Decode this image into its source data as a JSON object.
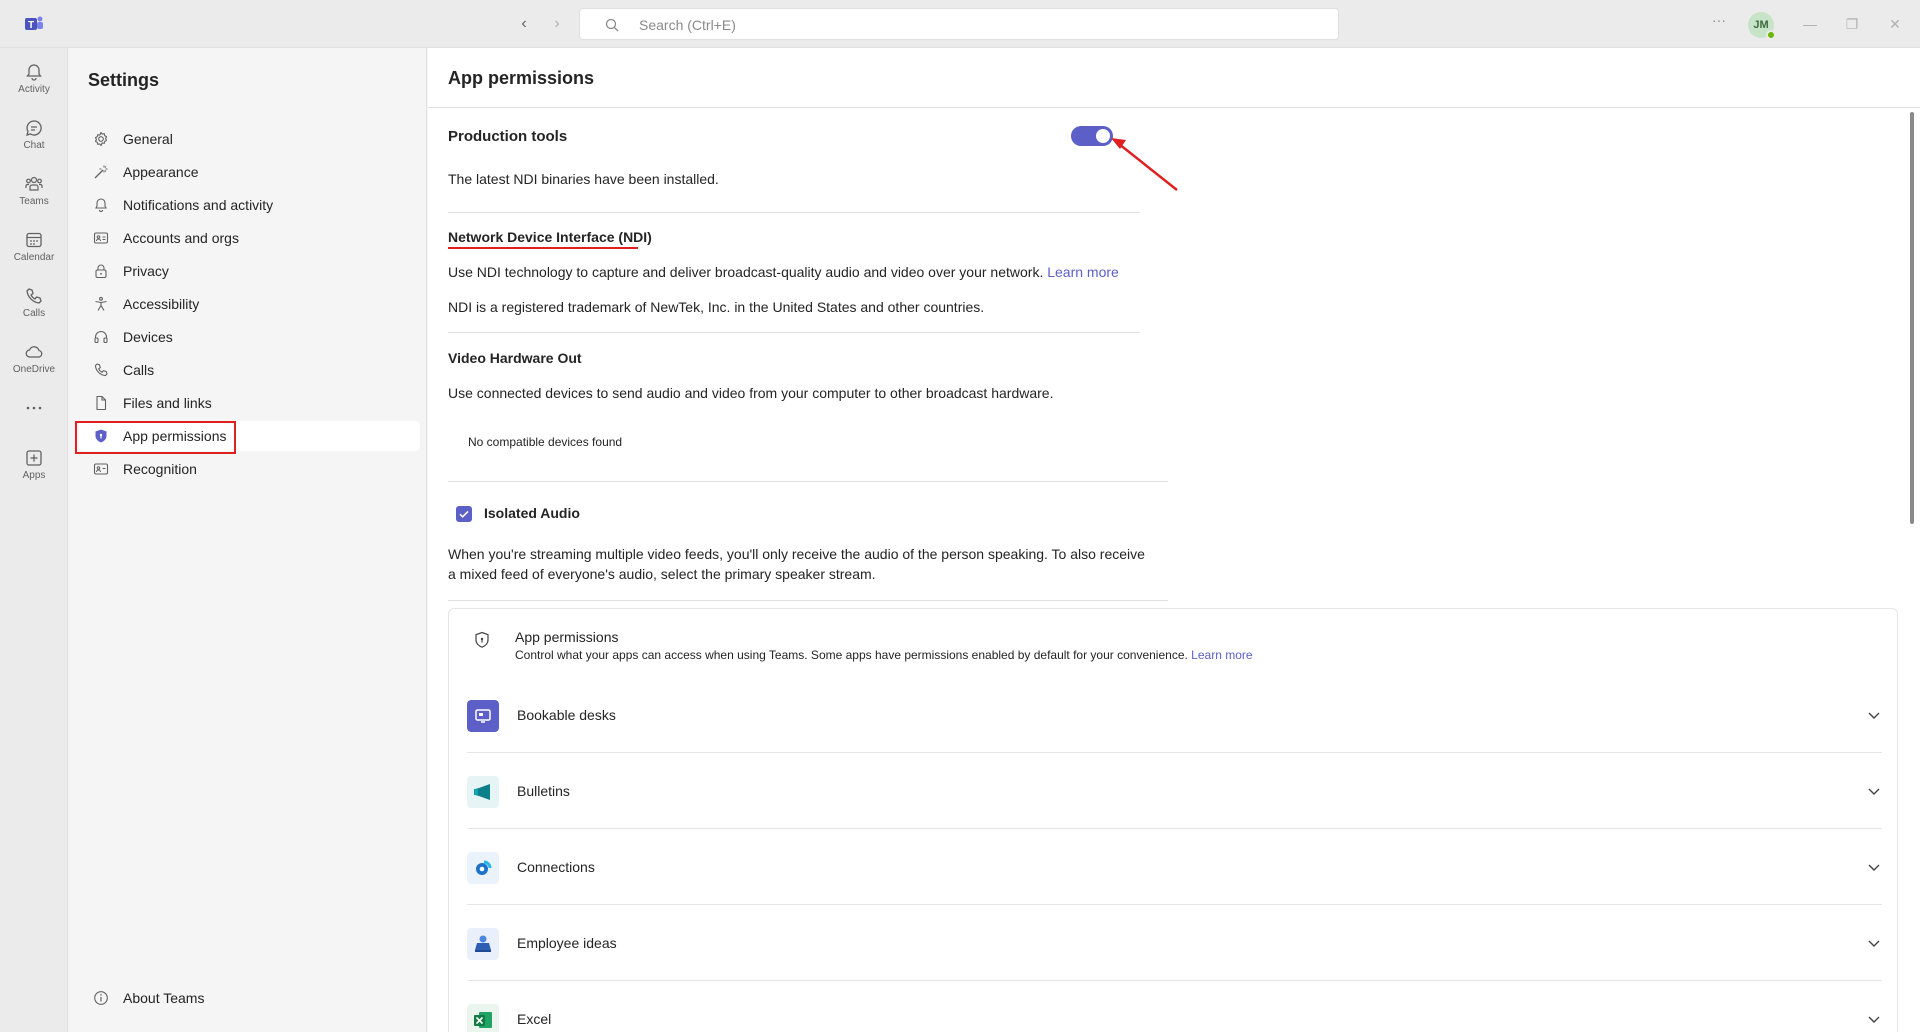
{
  "titlebar": {
    "search_placeholder": "Search (Ctrl+E)",
    "more_label": "···",
    "avatar_initials": "JM"
  },
  "rail": {
    "items": [
      {
        "label": "Activity",
        "icon": "bell-icon"
      },
      {
        "label": "Chat",
        "icon": "chat-icon"
      },
      {
        "label": "Teams",
        "icon": "teams-icon"
      },
      {
        "label": "Calendar",
        "icon": "calendar-icon"
      },
      {
        "label": "Calls",
        "icon": "phone-icon"
      },
      {
        "label": "OneDrive",
        "icon": "cloud-icon"
      },
      {
        "label": "",
        "icon": "more-icon"
      },
      {
        "label": "Apps",
        "icon": "add-apps-icon"
      }
    ]
  },
  "settings": {
    "title": "Settings",
    "items": [
      {
        "label": "General",
        "icon": "gear-icon"
      },
      {
        "label": "Appearance",
        "icon": "wand-icon"
      },
      {
        "label": "Notifications and activity",
        "icon": "bell-icon"
      },
      {
        "label": "Accounts and orgs",
        "icon": "id-card-icon"
      },
      {
        "label": "Privacy",
        "icon": "lock-icon"
      },
      {
        "label": "Accessibility",
        "icon": "accessibility-icon"
      },
      {
        "label": "Devices",
        "icon": "headset-icon"
      },
      {
        "label": "Calls",
        "icon": "phone-icon"
      },
      {
        "label": "Files and links",
        "icon": "document-icon"
      },
      {
        "label": "App permissions",
        "icon": "shield-icon"
      },
      {
        "label": "Recognition",
        "icon": "recognition-icon"
      }
    ],
    "about": "About Teams",
    "active_item": "App permissions"
  },
  "main": {
    "title": "App permissions",
    "production_tools": {
      "heading": "Production tools",
      "toggle_on": true,
      "status": "The latest NDI binaries have been installed."
    },
    "ndi": {
      "heading": "Network Device Interface (NDI)",
      "desc": "Use NDI technology to capture and deliver broadcast-quality audio and video over your network.",
      "learn_more": "Learn more",
      "trademark": "NDI is a registered trademark of NewTek, Inc. in the United States and other countries."
    },
    "video_out": {
      "heading": "Video Hardware Out",
      "desc": "Use connected devices to send audio and video from your computer to other broadcast hardware.",
      "no_devices": "No compatible devices found"
    },
    "isolated_audio": {
      "label": "Isolated Audio",
      "checked": true,
      "desc_line1": "When you're streaming multiple video feeds, you'll only receive the audio of the person speaking. To also receive",
      "desc_line2": "a mixed feed of everyone's audio, select the primary speaker stream."
    },
    "app_permissions": {
      "title": "App permissions",
      "desc": "Control what your apps can access when using Teams. Some apps have permissions enabled by default for your convenience.",
      "learn_more": "Learn more",
      "apps": [
        {
          "name": "Bookable desks",
          "color": "#5b5fc7"
        },
        {
          "name": "Bulletins",
          "color": "#0b7f8a"
        },
        {
          "name": "Connections",
          "color": "#1a73c8"
        },
        {
          "name": "Employee ideas",
          "color": "#2f5fb3"
        },
        {
          "name": "Excel",
          "color": "#107c41"
        }
      ]
    }
  },
  "colors": {
    "accent": "#5b5fc7",
    "annotation": "#e02020"
  }
}
